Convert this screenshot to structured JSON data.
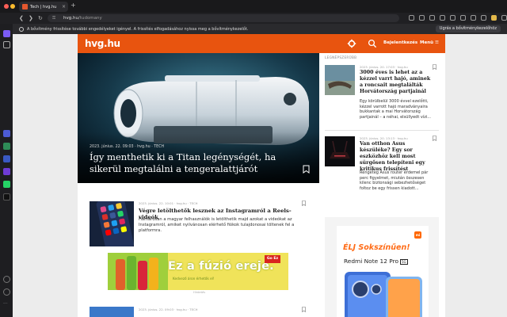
{
  "browser": {
    "tab_title": "Tech | hvg.hu",
    "tab_close": "×",
    "new_tab": "+",
    "url_domain": "hvg.hu",
    "url_path": "/tudomany",
    "notification": "A bővítmény frissítése további engedélyeket igényel. A frissítés elfogadásához nyissa meg a bővítménykezelőt.",
    "notification_button": "Ugrás a bővítménykezelőhöz"
  },
  "site": {
    "logo": "hvg.hu",
    "login": "Bejelentkezés",
    "menu": "Menü ☰",
    "accent": "#e8540f"
  },
  "hero": {
    "meta": "2023. június. 22. 09:03  ·  hvg.hu  ·  TECH",
    "title": "Így menthetik ki a Titan legénységét, ha sikerül megtalálni a tengeralattjárót"
  },
  "right_column": {
    "label": "LEGNÉPSZERŰBB",
    "articles": [
      {
        "meta": "2023. június. 20. 17:03  ·  hvg.hu",
        "title": "3000 éves is lehet az a kézzel varrt hajó, aminek a roncsait megtalálták Horvátország partjainál",
        "desc": "Egy körülbelül 3000 évvel ezelőtti, kézzel varrott hajó maradványaira bukkantak a mai Horvátország partjainál – a néhai, elsüllyedt vízi..."
      },
      {
        "meta": "2023. június. 20. 13:13  ·  hvg.hu",
        "title": "Van otthon Asus készüléke? Egy sor eszközhöz kell most sürgősen telepíteni egy kritikus frissítést",
        "desc": "Rengeteg Asus router érdemel pár perc figyelmet, miután összesen kilenc biztonsági sebezhetőséget foltoz be egy frissen kiadott..."
      }
    ]
  },
  "main_articles": [
    {
      "meta": "2023. június. 22. 10:01  ·  hvg.hu  ·  TECH",
      "title": "Végre letölthetők lesznek az Instagramról a Reels-videók",
      "desc": "Hamarosan a magyar felhasználók is letölthetik majd azokat a videókat az Instagramról, amiket nyilvánosan elérhető fiókok tulajdonosai töltenek fel a platformra."
    },
    {
      "meta": "2023. június. 22. 09:03  ·  hvg.hu  ·  TECH"
    }
  ],
  "ads": {
    "banner_text": "Ez a fúzió ereje.",
    "banner_small": "Kedvező áron érhetők el!",
    "banner_badge": "Go Ez",
    "banner_label": "Hirdetés",
    "side_brand": "mi",
    "side_slogan": "ÉLJ Sokszínűen!",
    "side_model": "Redmi Note 12 Pro",
    "side_model_badge": "5G"
  }
}
